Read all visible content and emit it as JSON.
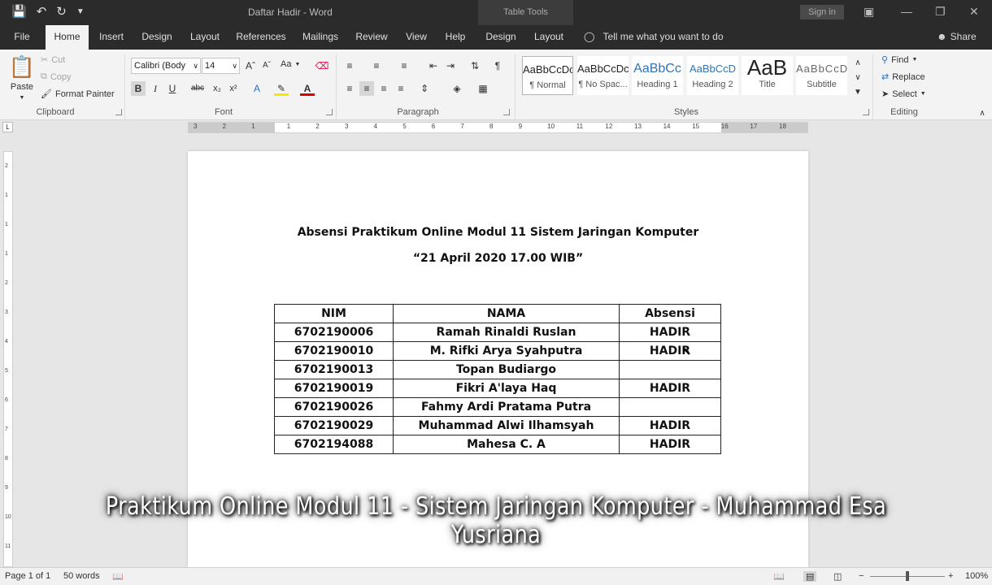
{
  "window": {
    "title": "Daftar Hadir  -  Word",
    "context_tab": "Table Tools",
    "sign_in": "Sign in"
  },
  "tabs": [
    "File",
    "Home",
    "Insert",
    "Design",
    "Layout",
    "References",
    "Mailings",
    "Review",
    "View",
    "Help",
    "Design",
    "Layout"
  ],
  "active_tab": "Home",
  "tell_me": "Tell me what you want to do",
  "share": "Share",
  "clipboard": {
    "paste": "Paste",
    "cut": "Cut",
    "copy": "Copy",
    "format_painter": "Format Painter",
    "label": "Clipboard"
  },
  "font": {
    "name": "Calibri (Body",
    "size": "14",
    "change_case": "Aa",
    "label": "Font"
  },
  "paragraph": {
    "label": "Paragraph"
  },
  "styles": {
    "label": "Styles",
    "items": [
      {
        "preview": "AaBbCcDc",
        "name": "¶ Normal"
      },
      {
        "preview": "AaBbCcDc",
        "name": "¶ No Spac..."
      },
      {
        "preview": "AaBbCc",
        "name": "Heading 1"
      },
      {
        "preview": "AaBbCcD",
        "name": "Heading 2"
      },
      {
        "preview": "AaB",
        "name": "Title"
      },
      {
        "preview": "AaBbCcD",
        "name": "Subtitle"
      }
    ]
  },
  "editing": {
    "find": "Find",
    "replace": "Replace",
    "select": "Select",
    "label": "Editing"
  },
  "ruler": {
    "h_numbers": [
      "3",
      "2",
      "1",
      "1",
      "2",
      "3",
      "4",
      "5",
      "6",
      "7",
      "8",
      "9",
      "10",
      "11",
      "12",
      "13",
      "14",
      "15",
      "16",
      "17",
      "18"
    ],
    "v_numbers": [
      "2",
      "1",
      "1",
      "1",
      "2",
      "3",
      "4",
      "5",
      "6",
      "7",
      "8",
      "9",
      "10",
      "11"
    ]
  },
  "document": {
    "title": "Absensi Praktikum Online Modul 11 Sistem Jaringan Komputer",
    "subtitle": "“21 April 2020 17.00 WIB”",
    "table": {
      "headers": [
        "NIM",
        "NAMA",
        "Absensi"
      ],
      "rows": [
        [
          "6702190006",
          "Ramah Rinaldi Ruslan",
          "HADIR"
        ],
        [
          "6702190010",
          "M. Rifki Arya Syahputra",
          "HADIR"
        ],
        [
          "6702190013",
          "Topan Budiargo",
          ""
        ],
        [
          "6702190019",
          "Fikri A'laya Haq",
          "HADIR"
        ],
        [
          "6702190026",
          "Fahmy Ardi Pratama Putra",
          ""
        ],
        [
          "6702190029",
          "Muhammad Alwi Ilhamsyah",
          "HADIR"
        ],
        [
          "6702194088",
          "Mahesa C. A",
          "HADIR"
        ]
      ]
    }
  },
  "caption": "Praktikum Online Modul 11 - Sistem Jaringan Komputer - Muhammad Esa Yusriana",
  "status": {
    "page": "Page 1 of 1",
    "words": "50 words",
    "zoom": "100%"
  }
}
